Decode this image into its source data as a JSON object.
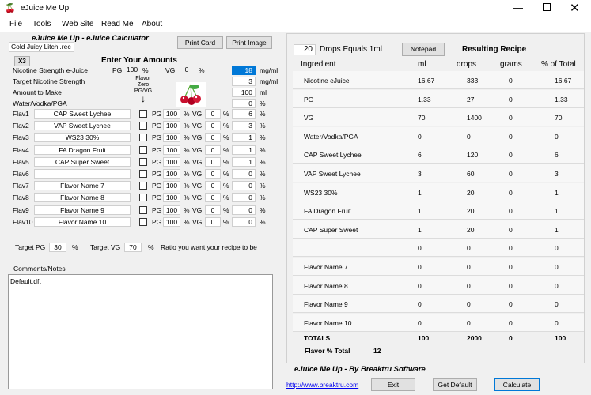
{
  "window": {
    "title": "eJuice Me Up"
  },
  "menu": [
    "File",
    "Tools",
    "Web Site",
    "Read Me",
    "About"
  ],
  "left": {
    "app_heading": "eJuice Me Up - eJuice Calculator",
    "print_card": "Print Card",
    "print_image": "Print Image",
    "recipe_file": "Cold Juicy Litchi.rec",
    "x3": "X3",
    "enter_amounts": "Enter Your Amounts",
    "nic_label": "Nicotine Strength e-Juice",
    "pg_label": "PG",
    "pg_value": "100",
    "pct": "%",
    "vg_label": "VG",
    "vg_value": "0",
    "nic_value": "18",
    "mgml": "mg/ml",
    "target_nic_label": "Target Nicotine Strength",
    "target_nic_value": "3",
    "amount_label": "Amount to Make",
    "amount_value": "100",
    "ml": "ml",
    "water_label": "Water/Vodka/PGA",
    "water_value": "0",
    "flavor_zero_line1": "Flavor",
    "flavor_zero_line2": "Zero",
    "flavor_zero_line3": "PG/VG",
    "flavor_zero_arrow": "↓",
    "flavors": [
      {
        "id": "Flav1",
        "name": "CAP Sweet Lychee",
        "pg": "100",
        "vg": "0",
        "pct": "6"
      },
      {
        "id": "Flav2",
        "name": "VAP Sweet Lychee",
        "pg": "100",
        "vg": "0",
        "pct": "3"
      },
      {
        "id": "Flav3",
        "name": "WS23 30%",
        "pg": "100",
        "vg": "0",
        "pct": "1"
      },
      {
        "id": "Flav4",
        "name": "FA Dragon Fruit",
        "pg": "100",
        "vg": "0",
        "pct": "1"
      },
      {
        "id": "Flav5",
        "name": "CAP Super Sweet",
        "pg": "100",
        "vg": "0",
        "pct": "1"
      },
      {
        "id": "Flav6",
        "name": "",
        "pg": "100",
        "vg": "0",
        "pct": "0"
      },
      {
        "id": "Flav7",
        "name": "Flavor Name 7",
        "pg": "100",
        "vg": "0",
        "pct": "0"
      },
      {
        "id": "Flav8",
        "name": "Flavor Name 8",
        "pg": "100",
        "vg": "0",
        "pct": "0"
      },
      {
        "id": "Flav9",
        "name": "Flavor Name 9",
        "pg": "100",
        "vg": "0",
        "pct": "0"
      },
      {
        "id": "Flav10",
        "name": "Flavor Name 10",
        "pg": "100",
        "vg": "0",
        "pct": "0"
      }
    ],
    "target_pg_label": "Target PG",
    "target_pg_value": "30",
    "target_vg_label": "Target VG",
    "target_vg_value": "70",
    "ratio_text": "Ratio you want your recipe to be",
    "comments_label": "Comments/Notes",
    "comments_text": "Default.dft"
  },
  "right": {
    "drops_value": "20",
    "drops_label": "Drops Equals 1ml",
    "notepad": "Notepad",
    "resulting_recipe": "Resulting Recipe",
    "headers": [
      "Ingredient",
      "ml",
      "drops",
      "grams",
      "% of Total"
    ],
    "rows": [
      [
        "Nicotine eJuice",
        "16.67",
        "333",
        "0",
        "16.67"
      ],
      [
        "PG",
        "1.33",
        "27",
        "0",
        "1.33"
      ],
      [
        "VG",
        "70",
        "1400",
        "0",
        "70"
      ],
      [
        "Water/Vodka/PGA",
        "0",
        "0",
        "0",
        "0"
      ],
      [
        "CAP Sweet Lychee",
        "6",
        "120",
        "0",
        "6"
      ],
      [
        "VAP Sweet Lychee",
        "3",
        "60",
        "0",
        "3"
      ],
      [
        "WS23 30%",
        "1",
        "20",
        "0",
        "1"
      ],
      [
        "FA Dragon Fruit",
        "1",
        "20",
        "0",
        "1"
      ],
      [
        "CAP Super Sweet",
        "1",
        "20",
        "0",
        "1"
      ],
      [
        "",
        "0",
        "0",
        "0",
        "0"
      ],
      [
        "Flavor Name 7",
        "0",
        "0",
        "0",
        "0"
      ],
      [
        "Flavor Name 8",
        "0",
        "0",
        "0",
        "0"
      ],
      [
        "Flavor Name 9",
        "0",
        "0",
        "0",
        "0"
      ],
      [
        "Flavor Name 10",
        "0",
        "0",
        "0",
        "0"
      ]
    ],
    "totals": [
      "TOTALS",
      "100",
      "2000",
      "0",
      "100"
    ],
    "flavor_total_label": "Flavor % Total",
    "flavor_total_value": "12",
    "footer_brand": "eJuice Me Up - By Breaktru Software",
    "link": "http://www.breaktru.com",
    "exit": "Exit",
    "get_default": "Get Default",
    "calculate": "Calculate"
  }
}
